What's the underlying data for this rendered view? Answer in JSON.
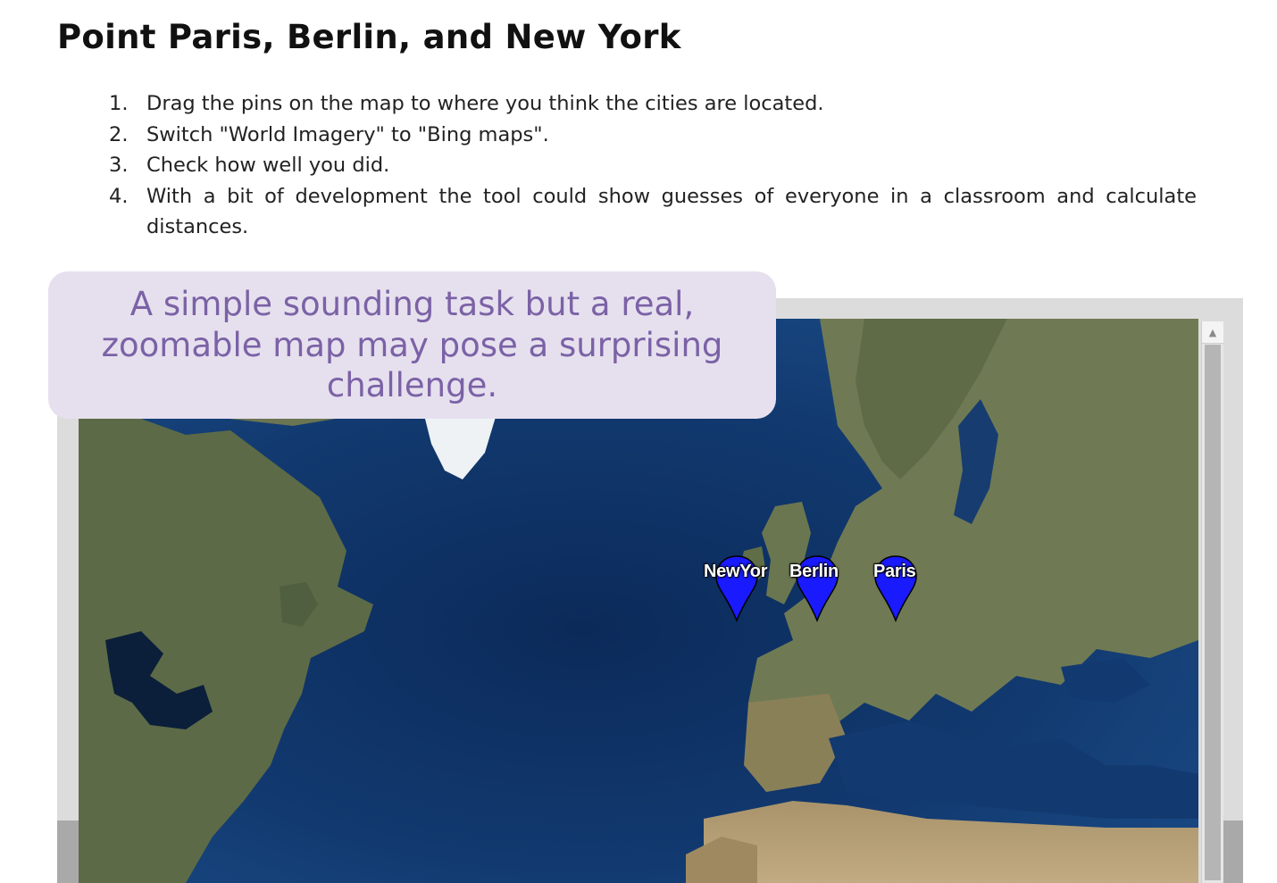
{
  "page": {
    "title": "Point Paris, Berlin, and New York",
    "steps": [
      {
        "num": "1.",
        "text": "Drag the pins on the map to where you think the cities are located."
      },
      {
        "num": "2.",
        "text": "Switch \"World Imagery\" to \"Bing maps\"."
      },
      {
        "num": "3.",
        "text": "Check how well you did."
      },
      {
        "num": "4.",
        "text": "With a bit of development the tool could show guesses of everyone in a classroom and calculate distances."
      }
    ]
  },
  "callout": {
    "text": "A simple sounding task but a real, zoomable map may pose a surprising challenge."
  },
  "map": {
    "pins": [
      {
        "label": "NewYor",
        "color": "#1a1aff"
      },
      {
        "label": "Berlin",
        "color": "#1a1aff"
      },
      {
        "label": "Paris",
        "color": "#1a1aff"
      }
    ]
  },
  "colors": {
    "callout_bg": "#e6e0ee",
    "callout_text": "#7b62a6",
    "ocean": "#0f2f5e",
    "pin": "#1a1aff"
  }
}
